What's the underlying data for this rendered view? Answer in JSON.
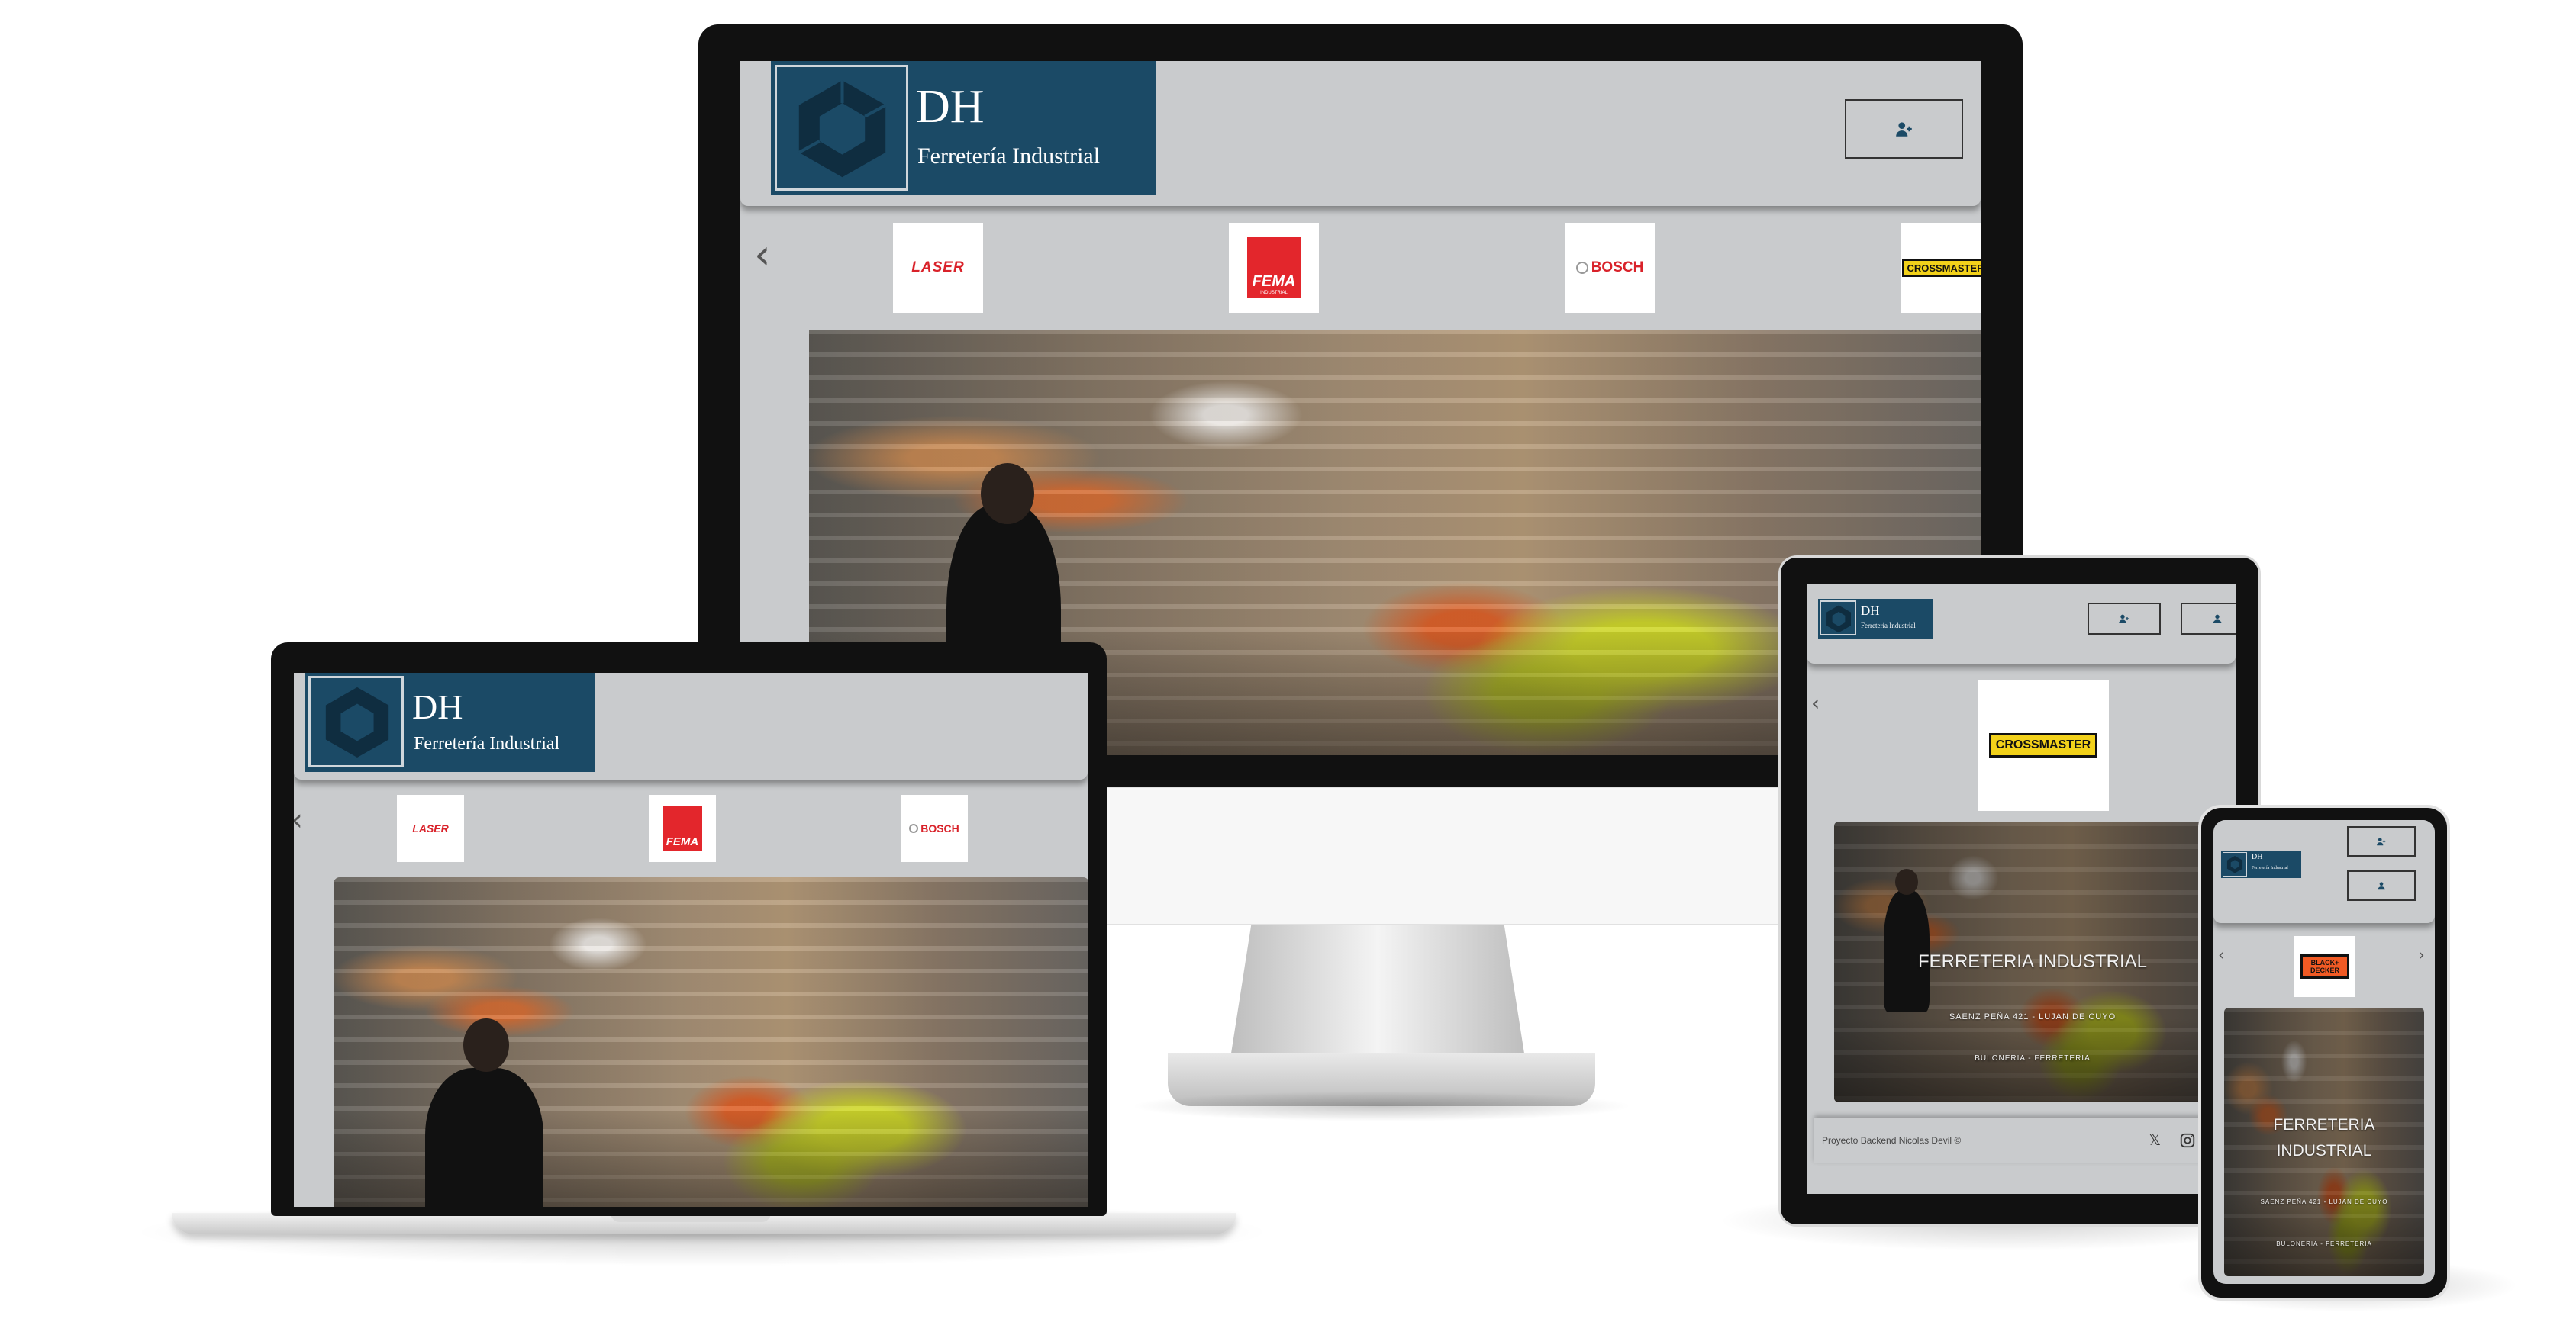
{
  "brand": {
    "logo_title": "DH",
    "logo_subtitle": "Ferretería Industrial"
  },
  "brands_carousel": {
    "items": [
      "LASER",
      "FEMA",
      "BOSCH",
      "CROSSMASTER",
      "BLACK+ DECKER"
    ],
    "fema_sub": "INDUSTRIAL"
  },
  "hero": {
    "title": "FERRETERIA INDUSTRIAL",
    "title_line1": "FERRETERIA",
    "title_line2": "INDUSTRIAL",
    "address": "SAENZ PEÑA 421 - LUJAN DE CUYO",
    "tagline": "BULONERIA - FERRETERIA"
  },
  "footer": {
    "credit": "Proyecto Backend Nicolas Devil ©"
  },
  "icons": {
    "user": "user-plus-icon",
    "login": "user-icon",
    "prev": "chevron-left-icon",
    "next": "chevron-right-icon",
    "x": "x-twitter-icon",
    "instagram": "instagram-icon"
  },
  "colors": {
    "logo_bg": "#1b4a66",
    "header_bg": "#c9cbcd",
    "device_frame": "#111111"
  }
}
